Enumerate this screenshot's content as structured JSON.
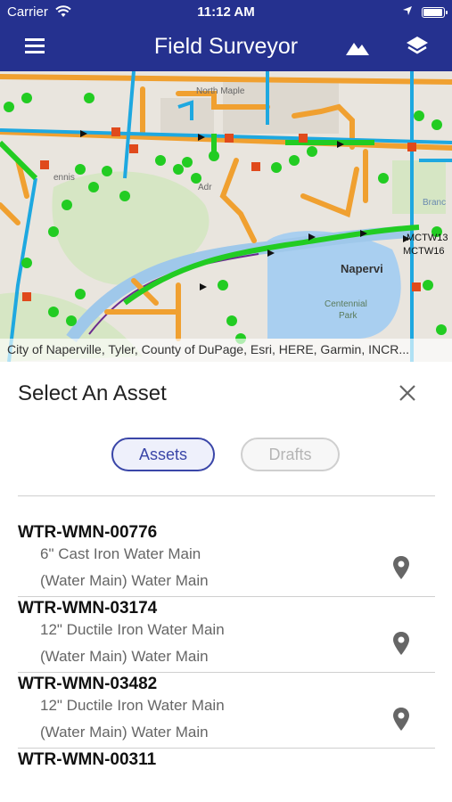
{
  "status": {
    "carrier": "Carrier",
    "time": "11:12 AM"
  },
  "nav": {
    "title": "Field Surveyor",
    "icons": [
      "menu-icon",
      "basemap-icon",
      "layers-icon"
    ]
  },
  "map": {
    "labels": {
      "north_maple": "North Maple",
      "naperville": "Napervi",
      "centennial": "Centennial",
      "park": "Park",
      "branch": "Branc",
      "adr": "Adr",
      "mctw1": "MCTW13",
      "mctw2": "MCTW16",
      "ennis": "ennis"
    },
    "attribution": "City of Naperville, Tyler, County of DuPage, Esri, HERE, Garmin, INCR..."
  },
  "panel": {
    "title": "Select An Asset",
    "tabs": {
      "assets": "Assets",
      "drafts": "Drafts"
    },
    "items": [
      {
        "id": "WTR-WMN-00776",
        "line1": "6\" Cast Iron Water Main",
        "line2": "(Water Main) Water Main"
      },
      {
        "id": "WTR-WMN-03174",
        "line1": "12\" Ductile Iron Water Main",
        "line2": "(Water Main) Water Main"
      },
      {
        "id": "WTR-WMN-03482",
        "line1": "12\" Ductile Iron Water Main",
        "line2": "(Water Main) Water Main"
      },
      {
        "id": "WTR-WMN-00311",
        "line1": "",
        "line2": ""
      }
    ]
  },
  "colors": {
    "navbar": "#25318f",
    "accent": "#3a46a8",
    "water_main": "#f0a030",
    "pipe_blue": "#1ea8e0",
    "green_asset": "#22cc22"
  }
}
